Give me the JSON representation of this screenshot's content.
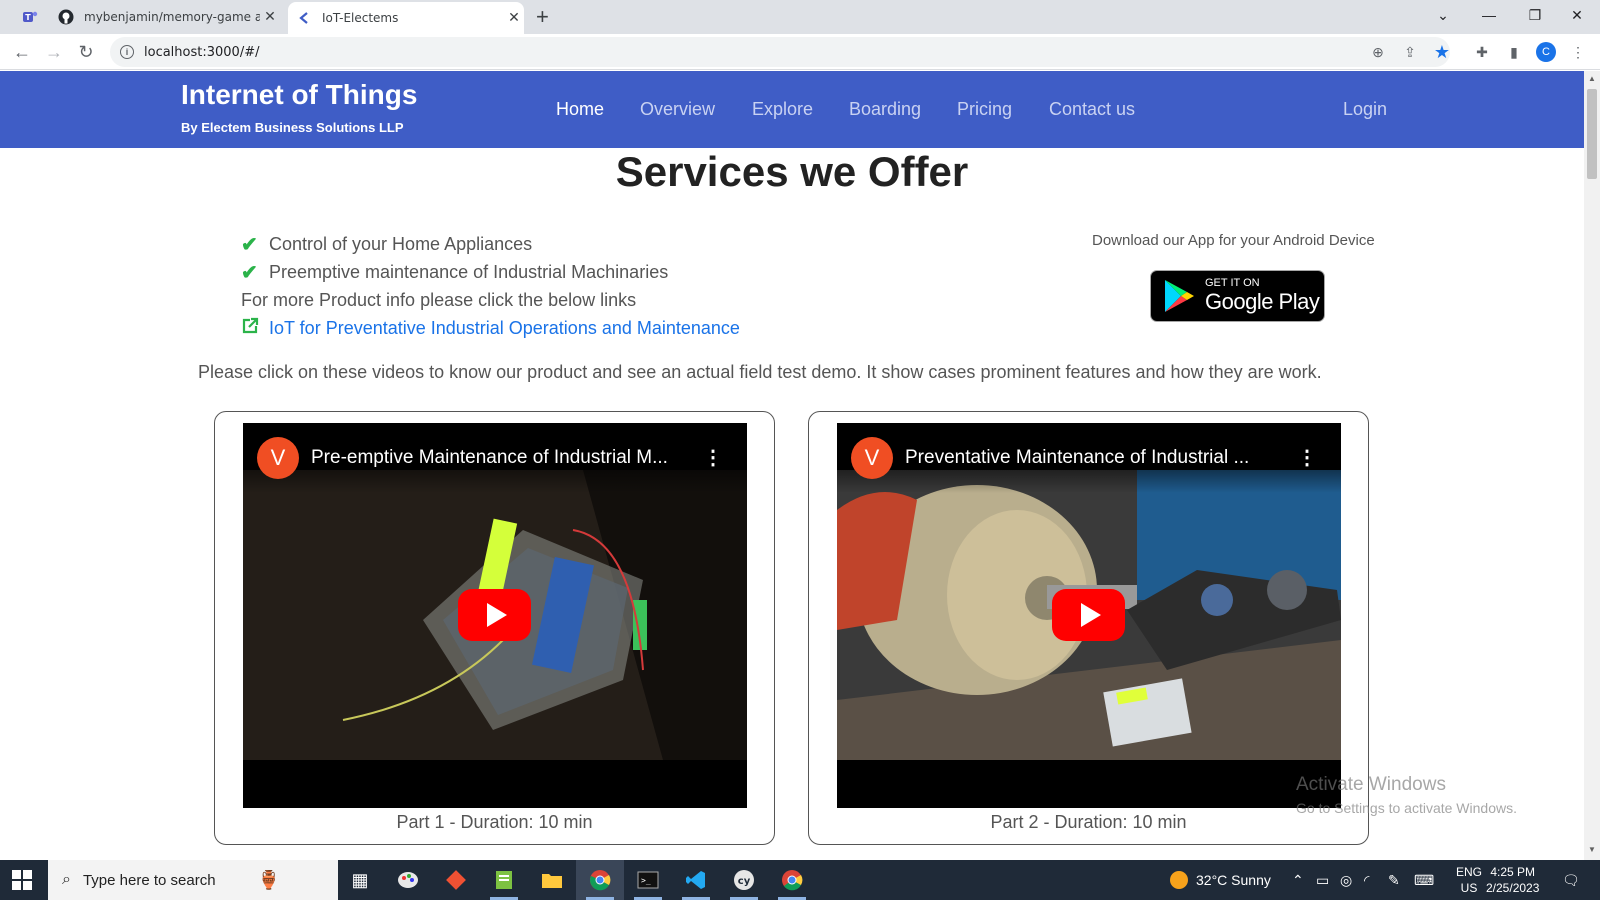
{
  "browser": {
    "tabs": [
      {
        "title": "",
        "icon": "teams-icon"
      },
      {
        "title": "mybenjamin/memory-game at b",
        "icon": "github-icon"
      },
      {
        "title": "IoT-Electems",
        "icon": "site-icon",
        "active": true
      }
    ],
    "url": "localhost:3000/#/",
    "profile_initial": "C"
  },
  "site": {
    "brand_title": "Internet of Things",
    "brand_subtitle": "By Electem Business Solutions LLP",
    "nav": [
      {
        "label": "Home",
        "active": true
      },
      {
        "label": "Overview"
      },
      {
        "label": "Explore"
      },
      {
        "label": "Boarding"
      },
      {
        "label": "Pricing"
      },
      {
        "label": "Contact us"
      }
    ],
    "login_label": "Login",
    "colors": {
      "nav_bg": "#3f5dc6",
      "check": "#2bb34a",
      "link": "#1a73e8"
    }
  },
  "main": {
    "heading": "Services we Offer",
    "services": [
      "Control of your Home Appliances",
      "Preemptive maintenance of Industrial Machinaries"
    ],
    "more_info": "For more Product info please click the below links",
    "product_link": "IoT for Preventative Industrial Operations and Maintenance",
    "download_text": "Download our App for your Android Device",
    "google_play": {
      "line1": "GET IT ON",
      "line2": "Google Play"
    },
    "intro": "Please click on these videos to know our product and see an actual field test demo. It show cases prominent features and how they are work.",
    "videos": [
      {
        "avatar": "V",
        "title": "Pre-emptive Maintenance of Industrial M...",
        "caption": "Part 1 - Duration: 10 min"
      },
      {
        "avatar": "V",
        "title": "Preventative Maintenance of Industrial ...",
        "caption": "Part 2 - Duration: 10 min"
      }
    ]
  },
  "watermark": {
    "line1": "Activate Windows",
    "line2": "Go to Settings to activate Windows."
  },
  "taskbar": {
    "search_placeholder": "Type here to search",
    "weather": "32°C  Sunny",
    "lang1": "ENG",
    "lang2": "US",
    "time": "4:25 PM",
    "date": "2/25/2023",
    "apps": [
      "task-view-icon",
      "paint-icon",
      "git-icon",
      "notepad-icon",
      "file-explorer-icon",
      "chrome-icon",
      "terminal-icon",
      "vscode-icon",
      "cypress-icon",
      "chrome-icon"
    ]
  }
}
